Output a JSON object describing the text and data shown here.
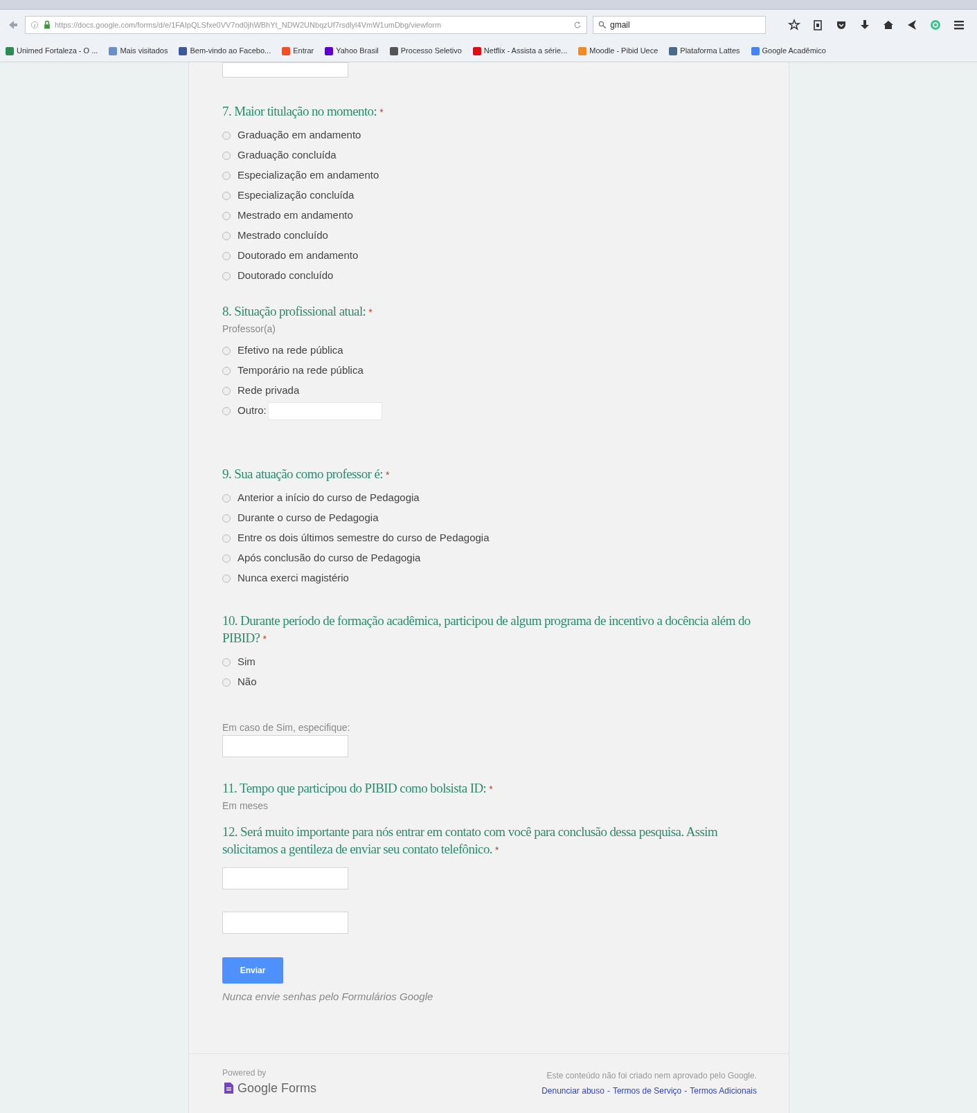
{
  "browser": {
    "address_bar": {
      "url": "https://docs.google.com/forms/d/e/1FAIpQLSfxe0VV7nd0jhWBhYt_NDW2UNbqzUf7rsdlyl4VmW1umDbg/viewform"
    },
    "search_field": {
      "value": "gmail"
    },
    "bookmarks": [
      {
        "label": "Unimed Fortaleza - O ...",
        "color": "#2e8b57"
      },
      {
        "label": "Mais visitados",
        "color": "#6a8fc8"
      },
      {
        "label": "Bem-vindo ao Facebo...",
        "color": "#3b5998"
      },
      {
        "label": "Entrar",
        "color": "#f25022"
      },
      {
        "label": "Yahoo Brasil",
        "color": "#5f01d1"
      },
      {
        "label": "Processo Seletivo",
        "color": "#555555"
      },
      {
        "label": "Netflix - Assista a série...",
        "color": "#e50914"
      },
      {
        "label": "Moodle - Pibid Uece",
        "color": "#f08a24"
      },
      {
        "label": "Plataforma Lattes",
        "color": "#4a6a8a"
      },
      {
        "label": "Google Acadêmico",
        "color": "#4285f4"
      }
    ]
  },
  "form": {
    "questions": [
      {
        "kind": "radio",
        "title": "7. Maior titulação no momento:",
        "required_mark": "*",
        "options": [
          {
            "label": "Graduação em andamento",
            "selected": false
          },
          {
            "label": "Graduação concluída",
            "selected": false
          },
          {
            "label": "Especialização em andamento",
            "selected": false
          },
          {
            "label": "Especialização concluída",
            "selected": false
          },
          {
            "label": "Mestrado em andamento",
            "selected": false
          },
          {
            "label": "Mestrado concluído",
            "selected": false
          },
          {
            "label": "Doutorado em andamento",
            "selected": false
          },
          {
            "label": "Doutorado concluído",
            "selected": false
          }
        ]
      },
      {
        "kind": "radio",
        "title": "8. Situação profissional atual:",
        "required_mark": "*",
        "help": "Professor(a)",
        "options": [
          {
            "label": "Efetivo na rede pública",
            "selected": false
          },
          {
            "label": "Temporário na rede pública",
            "selected": false
          },
          {
            "label": "Rede privada",
            "selected": false
          },
          {
            "label": "Outro:",
            "selected": false,
            "other_field": true
          }
        ]
      },
      {
        "kind": "radio",
        "title": "9. Sua atuação como professor é:",
        "required_mark": "*",
        "options": [
          {
            "label": "Anterior a início do curso de Pedagogia",
            "selected": false
          },
          {
            "label": "Durante o curso de Pedagogia",
            "selected": false
          },
          {
            "label": "Entre os dois últimos semestre do curso de Pedagogia",
            "selected": false
          },
          {
            "label": "Após conclusão do curso de Pedagogia",
            "selected": false
          },
          {
            "label": "Nunca exerci magistério",
            "selected": false
          }
        ]
      },
      {
        "kind": "radio",
        "title": "10. Durante período de formação acadêmica, participou de algum programa de incentivo a docência além do PIBID?",
        "required_mark": "*",
        "options": [
          {
            "label": "Sim",
            "selected": false
          },
          {
            "label": "Não",
            "selected": false
          }
        ]
      },
      {
        "kind": "text",
        "help": "Em caso de Sim, especifique:",
        "inputs": [
          {
            "kind": "text"
          }
        ]
      },
      {
        "kind": "heading",
        "title": "11. Tempo que participou do PIBID como bolsista ID:",
        "required_mark": "*",
        "help": "Em meses"
      },
      {
        "kind": "text",
        "title": "12. Será muito importante para nós entrar em contato com você para conclusão dessa pesquisa. Assim solicitamos a gentileza de enviar seu contato telefônico.",
        "required_mark": "*",
        "inputs": [
          {
            "kind": "text"
          },
          {
            "kind": "text"
          }
        ]
      }
    ],
    "submit_button": "Enviar",
    "password_note": "Nunca envie senhas pelo Formulários Google"
  },
  "footer": {
    "powered_by": "Powered by",
    "brand": "Google Forms",
    "disclaimer": "Este conteúdo não foi criado nem aprovado pelo Google.",
    "links": [
      {
        "label": "Denunciar abuso"
      },
      {
        "label": "Termos de Serviço"
      },
      {
        "label": "Termos Adicionais"
      }
    ],
    "separator": "-"
  }
}
